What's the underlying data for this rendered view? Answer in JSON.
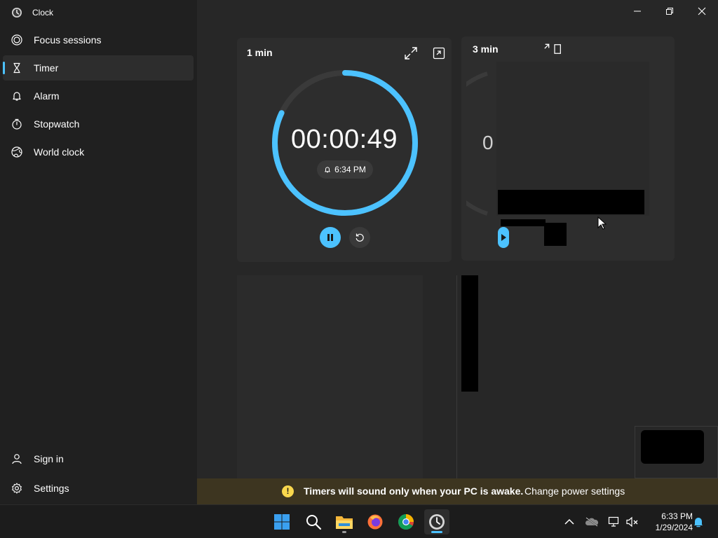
{
  "app": {
    "title": "Clock"
  },
  "nav": [
    {
      "label": "Focus sessions",
      "icon": "focus-icon"
    },
    {
      "label": "Timer",
      "icon": "hourglass-icon",
      "active": true
    },
    {
      "label": "Alarm",
      "icon": "bell-icon"
    },
    {
      "label": "Stopwatch",
      "icon": "stopwatch-icon"
    },
    {
      "label": "World clock",
      "icon": "globe-icon"
    }
  ],
  "nav_bottom": [
    {
      "label": "Sign in",
      "icon": "person-icon"
    },
    {
      "label": "Settings",
      "icon": "gear-icon"
    }
  ],
  "timers": [
    {
      "title": "1 min",
      "remaining": "00:00:49",
      "ends_at": "6:34 PM",
      "progress": 0.82,
      "state": "running"
    },
    {
      "title": "3 min",
      "remaining": "0",
      "state": "paused"
    }
  ],
  "banner": {
    "message": "Timers will sound only when your PC is awake.",
    "link": "Change power settings"
  },
  "taskbar": {
    "apps": [
      "start-icon",
      "search-icon",
      "file-explorer-icon",
      "firefox-icon",
      "chrome-icon",
      "clock-app-icon"
    ],
    "time": "6:33 PM",
    "date": "1/29/2024"
  },
  "colors": {
    "accent": "#4cc2ff",
    "warning": "#f9d74d",
    "banner_bg": "#3d3520"
  }
}
